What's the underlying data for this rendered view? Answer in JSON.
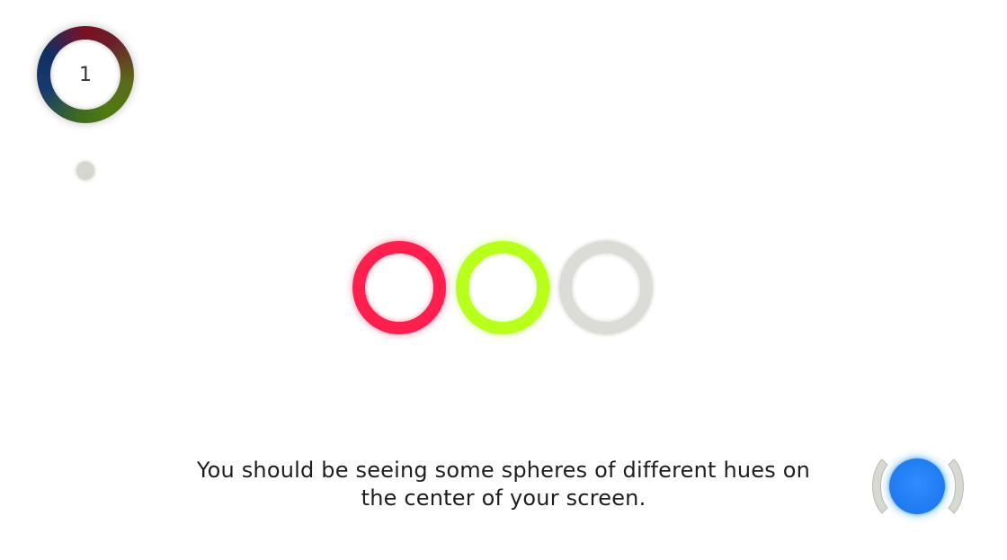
{
  "level": {
    "number": "1"
  },
  "rings": [
    {
      "id": "red",
      "color": "#ff1f4e"
    },
    {
      "id": "green",
      "color": "#b8ff1c"
    },
    {
      "id": "gray",
      "color": "#dcdcd6"
    }
  ],
  "instruction": {
    "line1": "You should be seeing some spheres of different hues on",
    "line2": "the center of your screen."
  },
  "next_button": {
    "color": "#2f8cff",
    "icon": "next-sphere-icon"
  }
}
